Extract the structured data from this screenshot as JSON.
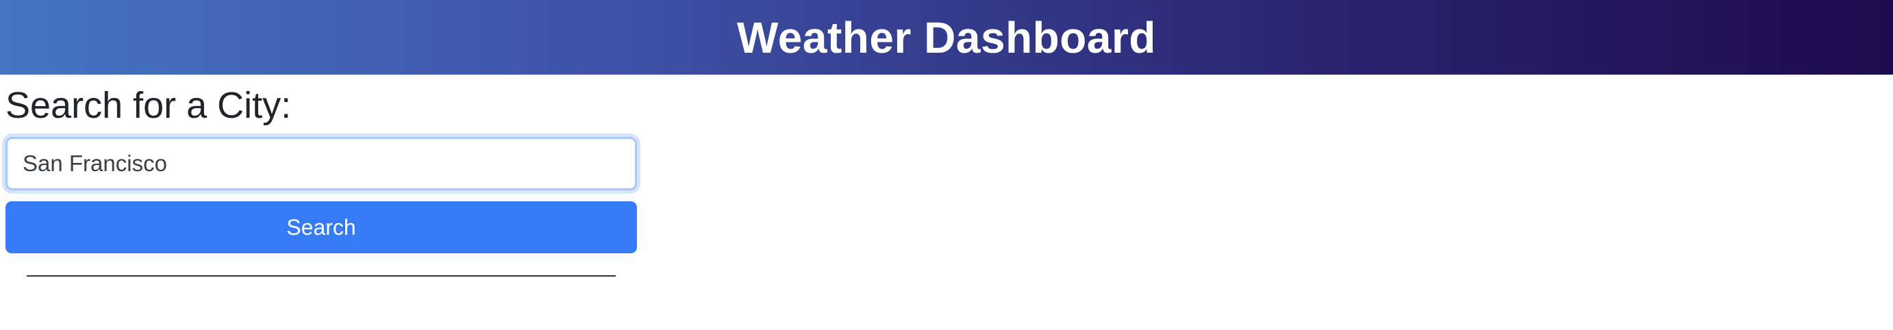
{
  "header": {
    "title": "Weather Dashboard"
  },
  "search": {
    "heading": "Search for a City:",
    "input_value": "San Francisco",
    "button_label": "Search"
  },
  "colors": {
    "header_gradient_start": "#4574c4",
    "header_gradient_end": "#1f0a4d",
    "button": "#367bf5"
  }
}
